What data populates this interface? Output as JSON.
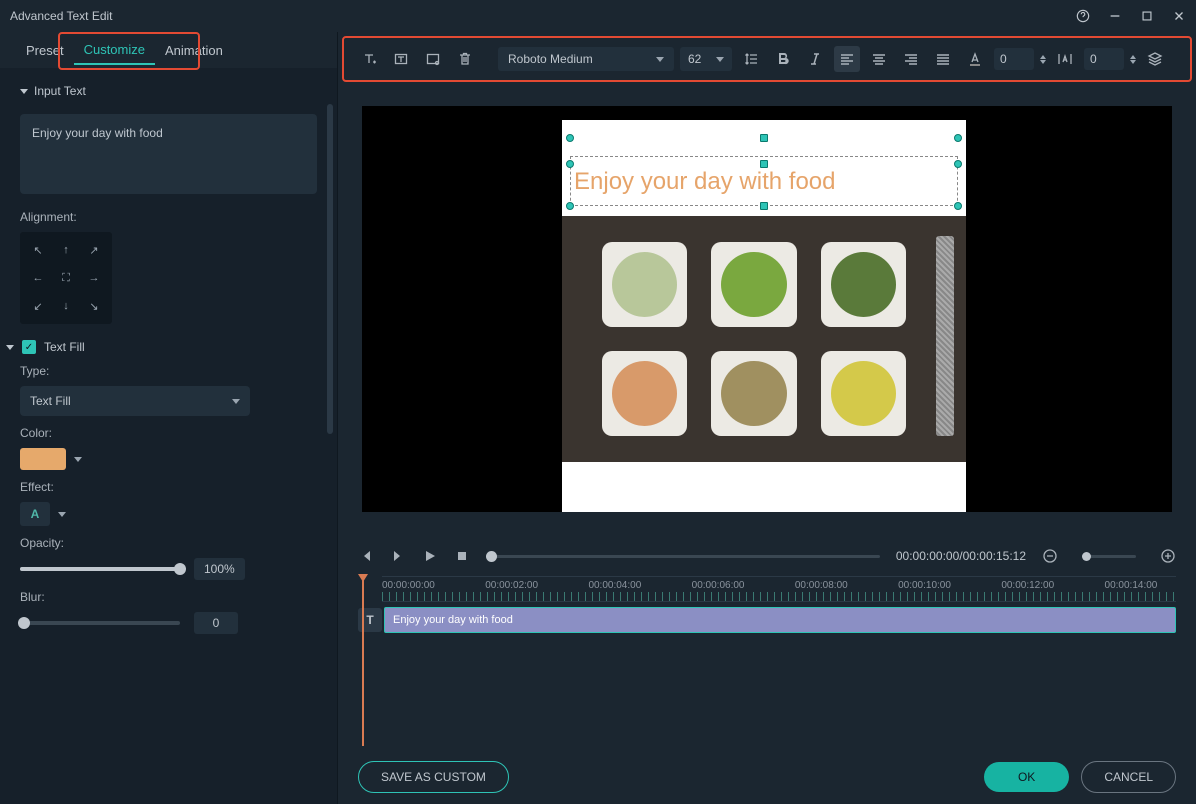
{
  "window": {
    "title": "Advanced Text Edit"
  },
  "tabs": {
    "preset": "Preset",
    "customize": "Customize",
    "animation": "Animation"
  },
  "side": {
    "input_text_hdr": "Input Text",
    "input_text_value": "Enjoy your day with food",
    "alignment_label": "Alignment:",
    "text_fill_hdr": "Text Fill",
    "type_label": "Type:",
    "type_value": "Text Fill",
    "color_label": "Color:",
    "color_hex": "#e6a96b",
    "effect_label": "Effect:",
    "effect_sample": "A",
    "opacity_label": "Opacity:",
    "opacity_value": "100%",
    "blur_label": "Blur:",
    "blur_value": "0"
  },
  "toolbar": {
    "font": "Roboto Medium",
    "size": "62",
    "line_height": "0",
    "letter_spacing": "0"
  },
  "canvas": {
    "overlay_text": "Enjoy your day with food"
  },
  "playback": {
    "time": "00:00:00:00/00:00:15:12"
  },
  "timeline": {
    "labels": [
      "00:00:00:00",
      "00:00:02:00",
      "00:00:04:00",
      "00:00:06:00",
      "00:00:08:00",
      "00:00:10:00",
      "00:00:12:00",
      "00:00:14:00"
    ],
    "clip_text": "Enjoy your day with food",
    "track_icon": "T"
  },
  "footer": {
    "save_custom": "SAVE AS CUSTOM",
    "ok": "OK",
    "cancel": "CANCEL"
  }
}
